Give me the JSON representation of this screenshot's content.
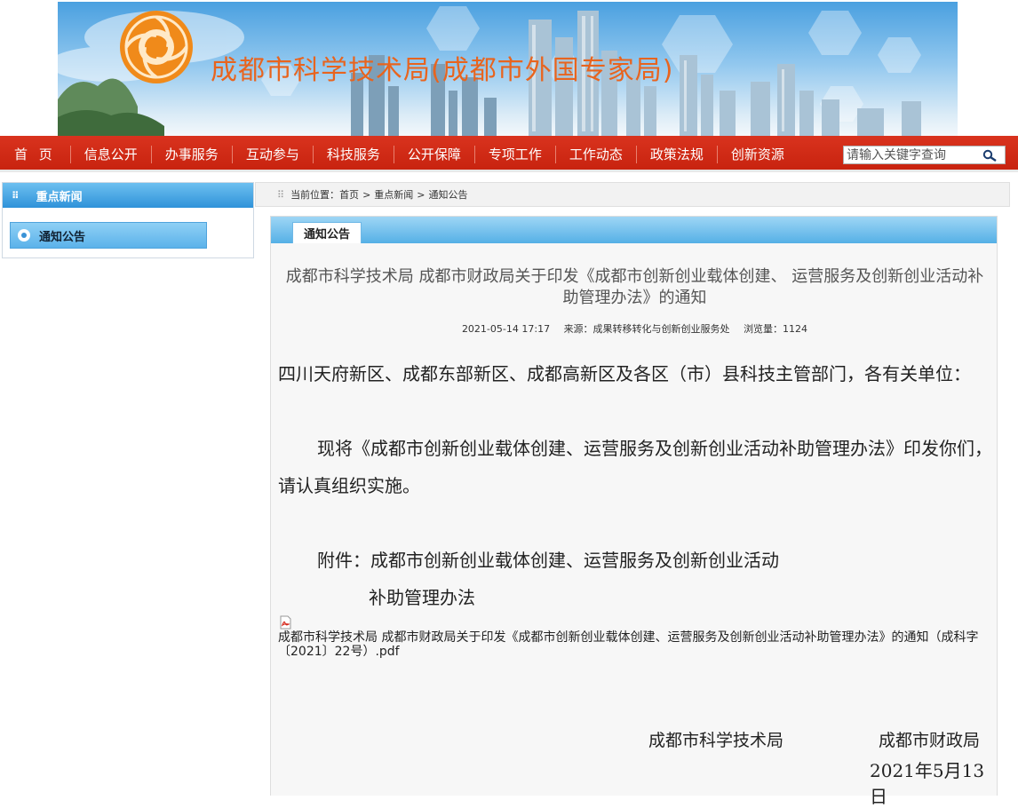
{
  "site": {
    "title": "成都市科学技术局(成都市外国专家局)"
  },
  "nav": {
    "items": [
      "首 页",
      "信息公开",
      "办事服务",
      "互动参与",
      "科技服务",
      "公开保障",
      "专项工作",
      "工作动态",
      "政策法规",
      "创新资源"
    ],
    "search_placeholder": "请输入关键字查询"
  },
  "sidebar": {
    "heading": "重点新闻",
    "items": [
      {
        "label": "通知公告"
      }
    ]
  },
  "breadcrumb": {
    "prefix": "当前位置：",
    "items": [
      "首页",
      "重点新闻",
      "通知公告"
    ]
  },
  "tab": {
    "label": "通知公告"
  },
  "article": {
    "title": "成都市科学技术局 成都市财政局关于印发《成都市创新创业载体创建、 运营服务及创新创业活动补助管理办法》的通知",
    "date": "2021-05-14 17:17",
    "source": "来源：成果转移转化与创新创业服务处",
    "views": "浏览量：1124",
    "para1": "四川天府新区、成都东部新区、成都高新区及各区（市）县科技主管部门，各有关单位：",
    "para2": "现将《成都市创新创业载体创建、运营服务及创新创业活动补助管理办法》印发你们，请认真组织实施。",
    "attachment_line1": "附件：成都市创新创业载体创建、运营服务及创新创业活动",
    "attachment_line2": "补助管理办法",
    "attachment_file": "成都市科学技术局 成都市财政局关于印发《成都市创新创业载体创建、运营服务及创新创业活动补助管理办法》的通知（成科字〔2021〕22号）.pdf",
    "signer1": "成都市科学技术局",
    "signer2": "成都市财政局",
    "sign_date": "2021年5月13日"
  },
  "colors": {
    "nav_red": "#c8230f",
    "accent_blue": "#3a93d6",
    "banner_title_orange": "#e8641e"
  }
}
